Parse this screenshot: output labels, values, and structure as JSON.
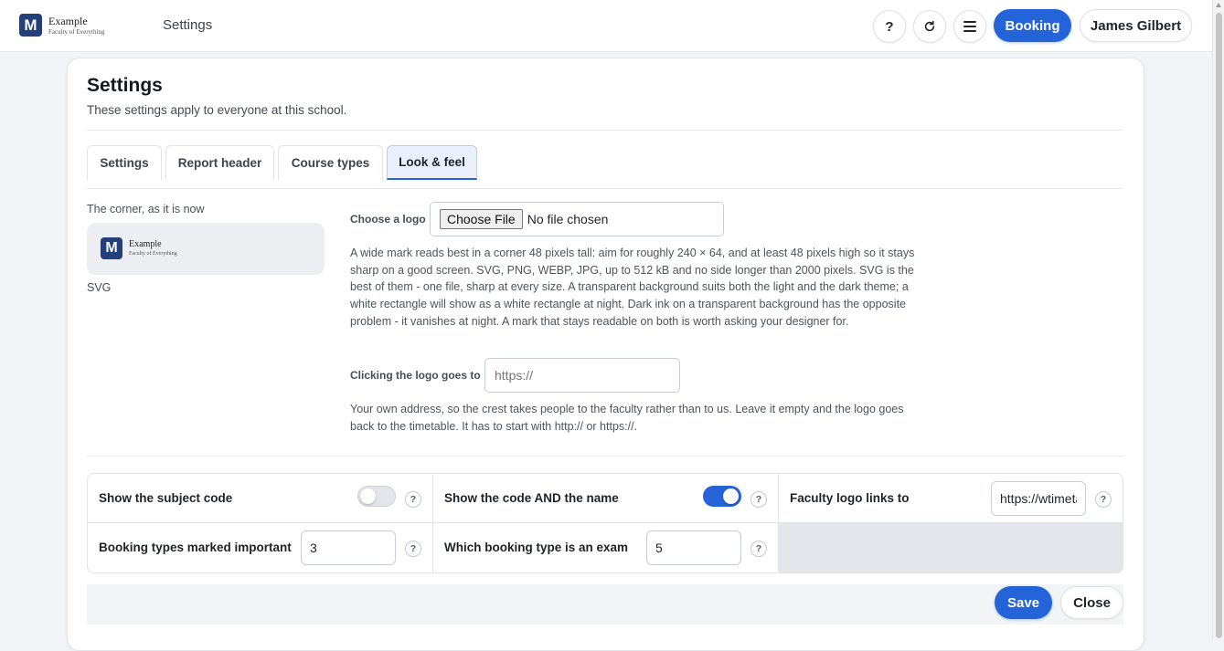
{
  "header": {
    "brand_letter": "M",
    "brand_name": "Example",
    "brand_sub": "Faculty of Everything",
    "page_title": "Settings",
    "help_label": "?",
    "booking_label": "Booking",
    "user_name": "James Gilbert"
  },
  "page": {
    "title": "Settings",
    "subtitle": "These settings apply to everyone at this school."
  },
  "tabs": [
    {
      "label": "Settings",
      "active": false
    },
    {
      "label": "Report header",
      "active": false
    },
    {
      "label": "Course types",
      "active": false
    },
    {
      "label": "Look & feel",
      "active": true
    }
  ],
  "look": {
    "corner_label": "The corner, as it is now",
    "preview_letter": "M",
    "preview_name": "Example",
    "preview_sub": "Faculty of Everything",
    "format_label": "SVG",
    "choose_logo_label": "Choose a logo",
    "file_button_label": "Choose File",
    "file_status": "No file chosen",
    "logo_help": "A wide mark reads best in a corner 48 pixels tall: aim for roughly 240 × 64, and at least 48 pixels high so it stays sharp on a good screen. SVG, PNG, WEBP, JPG, up to 512 kB and no side longer than 2000 pixels. SVG is the best of them - one file, sharp at every size. A transparent background suits both the light and the dark theme; a white rectangle will show as a white rectangle at night. Dark ink on a transparent background has the opposite problem - it vanishes at night. A mark that stays readable on both is worth asking your designer for.",
    "click_label": "Clicking the logo goes to",
    "click_placeholder": "https://",
    "click_help": "Your own address, so the crest takes people to the faculty rather than to us. Leave it empty and the logo goes back to the timetable. It has to start with http:// or https://."
  },
  "options": {
    "show_subject_code": {
      "label": "Show the subject code",
      "on": false
    },
    "show_code_and_name": {
      "label": "Show the code AND the name",
      "on": true
    },
    "faculty_logo_links": {
      "label": "Faculty logo links to",
      "value": "https://wtimetable.example.ac.uk"
    },
    "booking_types_important": {
      "label": "Booking types marked important",
      "value": "3"
    },
    "exam_booking_type": {
      "label": "Which booking type is an exam",
      "value": "5"
    },
    "help_glyph": "?"
  },
  "footer": {
    "save_label": "Save",
    "close_label": "Close"
  },
  "colors": {
    "accent": "#2563d9",
    "brand": "#23407a",
    "page_bg": "#f1f3f7"
  }
}
